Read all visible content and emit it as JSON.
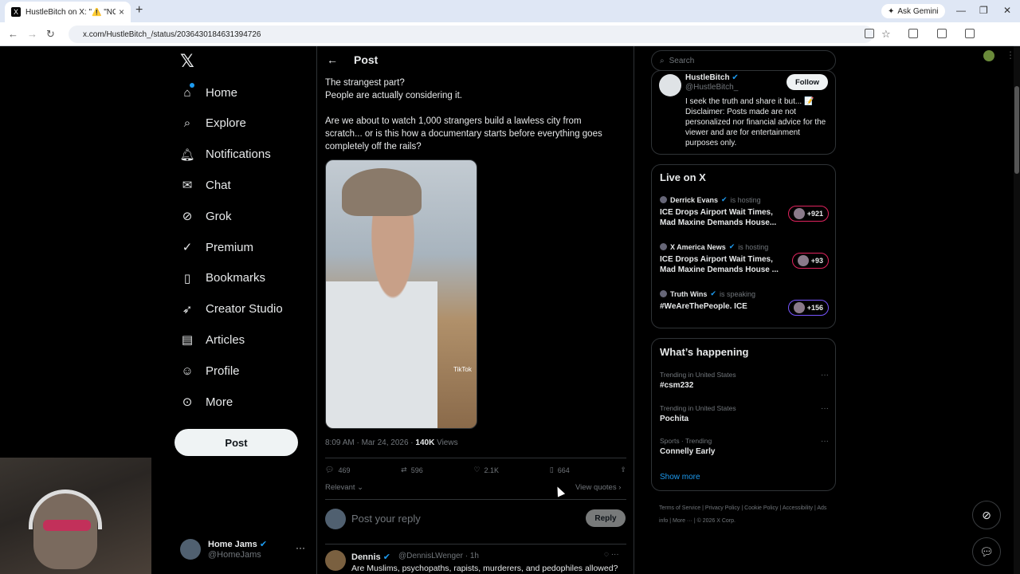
{
  "browser": {
    "tab_title": "HustleBitch on X: \"⚠️ \"NO",
    "url": "x.com/HustleBitch_/status/2036430184631394726",
    "gemini_label": "Ask Gemini"
  },
  "nav": {
    "items": [
      {
        "label": "Home",
        "icon": "home-icon"
      },
      {
        "label": "Explore",
        "icon": "search-icon"
      },
      {
        "label": "Notifications",
        "icon": "bell-icon"
      },
      {
        "label": "Chat",
        "icon": "mail-icon"
      },
      {
        "label": "Grok",
        "icon": "grok-icon"
      },
      {
        "label": "Premium",
        "icon": "verified-icon"
      },
      {
        "label": "Bookmarks",
        "icon": "bookmark-icon"
      },
      {
        "label": "Creator Studio",
        "icon": "rocket-icon"
      },
      {
        "label": "Articles",
        "icon": "article-icon"
      },
      {
        "label": "Profile",
        "icon": "person-icon"
      },
      {
        "label": "More",
        "icon": "more-icon"
      }
    ],
    "post_button": "Post",
    "account": {
      "name": "Home Jams",
      "handle": "@HomeJams"
    }
  },
  "post": {
    "header_title": "Post",
    "text_line1": "The strangest part?",
    "text_line2": "People are actually considering it.",
    "text_para2": "Are we about to watch 1,000 strangers build a lawless city from scratch... or is this how a documentary starts before everything goes completely off the rails?",
    "media_watermark": "TikTok",
    "timestamp": "8:09 AM · Mar 24, 2026 · ",
    "views_count": "140K",
    "views_label": " Views",
    "replies": "469",
    "reposts": "596",
    "likes": "2.1K",
    "bookmarks": "664",
    "sort_label": "Relevant",
    "view_quotes": "View quotes",
    "reply_placeholder": "Post your reply",
    "reply_button": "Reply"
  },
  "reply": {
    "name": "Dennis",
    "handle": "@DennisLWenger · 1h",
    "text": "Are Muslims, psychopaths, rapists, murderers, and pedophiles allowed?"
  },
  "sidebar": {
    "search_placeholder": "Search",
    "profile": {
      "name": "HustleBitch",
      "handle": "@HustleBitch_",
      "follow": "Follow",
      "bio": "I seek the truth and share it but... 📝 Disclaimer: Posts made are not personalized nor financial advice for the viewer and are for entertainment purposes only."
    },
    "live_title": "Live on X",
    "live": [
      {
        "host": "Derrick Evans",
        "status": "is hosting",
        "title": "ICE Drops Airport Wait Times, Mad Maxine Demands House...",
        "count": "+921"
      },
      {
        "host": "X America News",
        "status": "is hosting",
        "title": "ICE Drops Airport Wait Times, Mad Maxine Demands House ...",
        "count": "+93"
      },
      {
        "host": "Truth Wins",
        "status": "is speaking",
        "title": "#WeAreThePeople. ICE",
        "count": "+156"
      }
    ],
    "happening_title": "What’s happening",
    "trends": [
      {
        "context": "Trending in United States",
        "topic": "#csm232"
      },
      {
        "context": "Trending in United States",
        "topic": "Pochita"
      },
      {
        "context": "Sports · Trending",
        "topic": "Connelly Early"
      }
    ],
    "show_more": "Show more",
    "footer": [
      "Terms of Service",
      "Privacy Policy",
      "Cookie Policy",
      "Accessibility",
      "Ads info",
      "More ···",
      "© 2026 X Corp."
    ]
  },
  "colors": {
    "accent": "#1d9bf0",
    "background": "#000000",
    "live_ring": "#e0245e"
  }
}
